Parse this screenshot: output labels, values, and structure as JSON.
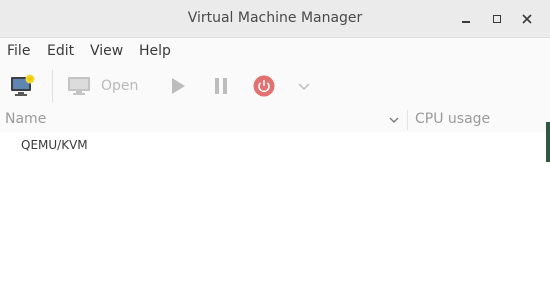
{
  "window": {
    "title": "Virtual Machine Manager"
  },
  "menubar": {
    "items": [
      "File",
      "Edit",
      "View",
      "Help"
    ]
  },
  "toolbar": {
    "new_vm_icon": "new-vm-icon",
    "open_label": "Open",
    "run_icon": "play-icon",
    "pause_icon": "pause-icon",
    "shutdown_icon": "power-icon",
    "more_icon": "chevron-down-icon"
  },
  "list": {
    "columns": [
      "Name",
      "CPU usage"
    ],
    "rows": [
      {
        "name": "QEMU/KVM"
      }
    ]
  },
  "colors": {
    "titlebar": "#ebebeb",
    "power_accent": "#e06060",
    "disabled_text": "#b9b9b9"
  }
}
